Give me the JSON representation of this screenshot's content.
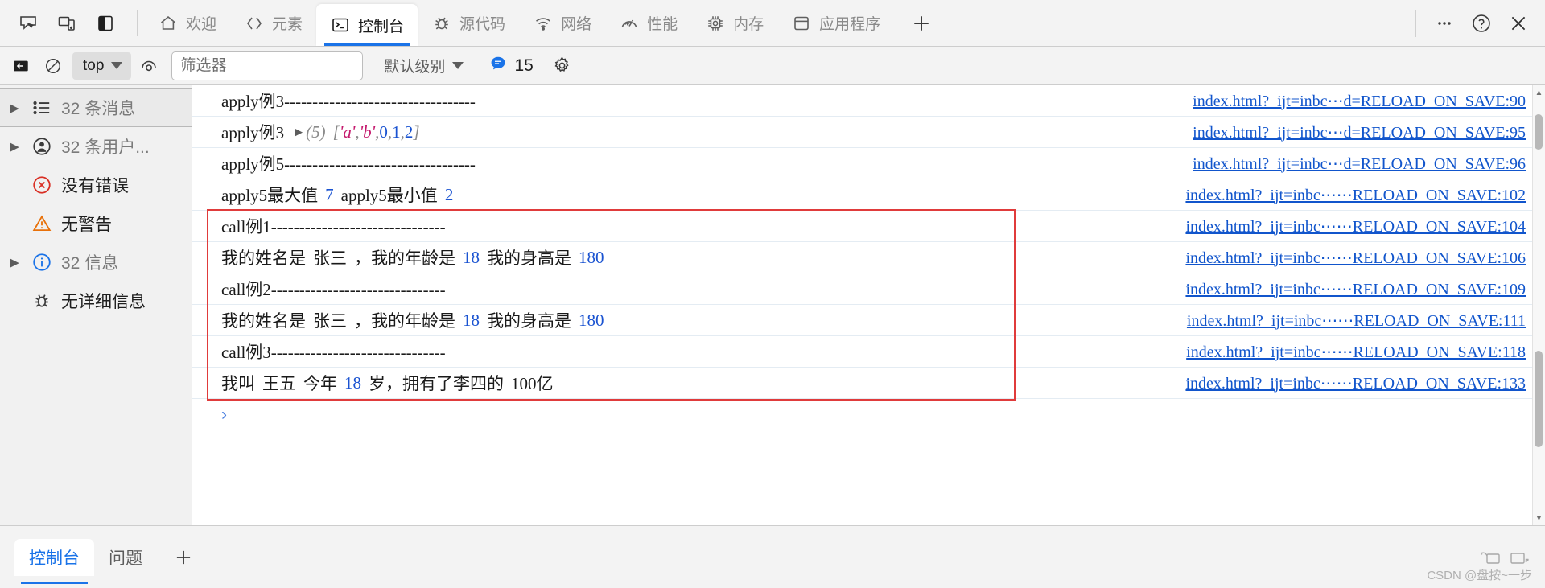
{
  "window": {
    "devtools_icons": [
      "inspect-element-icon",
      "device-toolbar-icon",
      "dock-panel-icon"
    ],
    "more_label": "⋯",
    "help_label": "?",
    "close_label": "✕"
  },
  "tabs": [
    {
      "id": "welcome",
      "label": "欢迎",
      "icon": "home-icon",
      "active": false
    },
    {
      "id": "elements",
      "label": "元素",
      "icon": "code-icon",
      "active": false
    },
    {
      "id": "console",
      "label": "控制台",
      "icon": "console-icon",
      "active": true
    },
    {
      "id": "sources",
      "label": "源代码",
      "icon": "bug-icon",
      "active": false
    },
    {
      "id": "network",
      "label": "网络",
      "icon": "wifi-icon",
      "active": false
    },
    {
      "id": "performance",
      "label": "性能",
      "icon": "gauge-icon",
      "active": false
    },
    {
      "id": "memory",
      "label": "内存",
      "icon": "chip-icon",
      "active": false
    },
    {
      "id": "application",
      "label": "应用程序",
      "icon": "database-icon",
      "active": false
    }
  ],
  "tab_add_label": "+",
  "console_toolbar": {
    "sidebar_toggle_icon": "show-console-sidebar-icon",
    "clear_icon": "clear-console-icon",
    "context": "top",
    "eye_icon": "live-expression-icon",
    "filter_placeholder": "筛选器",
    "filter_value": "",
    "level_label": "默认级别",
    "message_count": "15",
    "message_icon": "speech-bubble-icon",
    "settings_icon": "gear-icon",
    "accent_blue": "#1a73e8"
  },
  "sidebar": {
    "items": [
      {
        "label": "32 条消息",
        "icon": "list-icon",
        "arrow": true,
        "selected": true,
        "tone": "muted"
      },
      {
        "label": "32 条用户...",
        "icon": "user-icon",
        "arrow": true,
        "selected": false,
        "tone": "muted"
      },
      {
        "label": "没有错误",
        "icon": "error-icon",
        "arrow": false,
        "selected": false,
        "tone": "dark"
      },
      {
        "label": "无警告",
        "icon": "warning-icon",
        "arrow": false,
        "selected": false,
        "tone": "dark"
      },
      {
        "label": "32 信息",
        "icon": "info-icon",
        "arrow": true,
        "selected": false,
        "tone": "muted"
      },
      {
        "label": "无详细信息",
        "icon": "verbose-bug-icon",
        "arrow": false,
        "selected": false,
        "tone": "dark"
      }
    ]
  },
  "console_logs": [
    {
      "parts": [
        {
          "t": "text",
          "v": "apply例3----------------------------------"
        }
      ],
      "source": "index.html?_ijt=inbc⋯d=RELOAD_ON_SAVE:90"
    },
    {
      "parts": [
        {
          "t": "text",
          "v": "apply例3"
        },
        {
          "t": "gap"
        },
        {
          "t": "disclose",
          "v": "▶"
        },
        {
          "t": "meta",
          "v": "(5)"
        },
        {
          "t": "gap"
        },
        {
          "t": "meta",
          "v": "["
        },
        {
          "t": "str",
          "v": "'a'"
        },
        {
          "t": "meta",
          "v": ", "
        },
        {
          "t": "str",
          "v": "'b'"
        },
        {
          "t": "meta",
          "v": ", "
        },
        {
          "t": "num",
          "v": "0"
        },
        {
          "t": "meta",
          "v": ", "
        },
        {
          "t": "num",
          "v": "1"
        },
        {
          "t": "meta",
          "v": ", "
        },
        {
          "t": "num",
          "v": "2"
        },
        {
          "t": "meta",
          "v": "]"
        }
      ],
      "source": "index.html?_ijt=inbc⋯d=RELOAD_ON_SAVE:95"
    },
    {
      "parts": [
        {
          "t": "text",
          "v": "apply例5----------------------------------"
        }
      ],
      "source": "index.html?_ijt=inbc⋯d=RELOAD_ON_SAVE:96"
    },
    {
      "parts": [
        {
          "t": "text",
          "v": "apply5最大值"
        },
        {
          "t": "gap"
        },
        {
          "t": "num",
          "v": "7"
        },
        {
          "t": "gap"
        },
        {
          "t": "text",
          "v": "apply5最小值"
        },
        {
          "t": "gap"
        },
        {
          "t": "num",
          "v": "2"
        }
      ],
      "source": "index.html?_ijt=inbc⋯⋯RELOAD_ON_SAVE:102"
    },
    {
      "parts": [
        {
          "t": "text",
          "v": "call例1-------------------------------"
        }
      ],
      "source": "index.html?_ijt=inbc⋯⋯RELOAD_ON_SAVE:104",
      "boxed": true
    },
    {
      "parts": [
        {
          "t": "text",
          "v": "我的姓名是"
        },
        {
          "t": "gap"
        },
        {
          "t": "text",
          "v": "张三"
        },
        {
          "t": "gap"
        },
        {
          "t": "text",
          "v": "，我的年龄是"
        },
        {
          "t": "gap"
        },
        {
          "t": "num",
          "v": "18"
        },
        {
          "t": "gap"
        },
        {
          "t": "text",
          "v": "我的身高是"
        },
        {
          "t": "gap"
        },
        {
          "t": "num",
          "v": "180"
        }
      ],
      "source": "index.html?_ijt=inbc⋯⋯RELOAD_ON_SAVE:106",
      "boxed": true
    },
    {
      "parts": [
        {
          "t": "text",
          "v": "call例2-------------------------------"
        }
      ],
      "source": "index.html?_ijt=inbc⋯⋯RELOAD_ON_SAVE:109",
      "boxed": true
    },
    {
      "parts": [
        {
          "t": "text",
          "v": "我的姓名是"
        },
        {
          "t": "gap"
        },
        {
          "t": "text",
          "v": "张三"
        },
        {
          "t": "gap"
        },
        {
          "t": "text",
          "v": "，我的年龄是"
        },
        {
          "t": "gap"
        },
        {
          "t": "num",
          "v": "18"
        },
        {
          "t": "gap"
        },
        {
          "t": "text",
          "v": "我的身高是"
        },
        {
          "t": "gap"
        },
        {
          "t": "num",
          "v": "180"
        }
      ],
      "source": "index.html?_ijt=inbc⋯⋯RELOAD_ON_SAVE:111",
      "boxed": true
    },
    {
      "parts": [
        {
          "t": "text",
          "v": "call例3-------------------------------"
        }
      ],
      "source": "index.html?_ijt=inbc⋯⋯RELOAD_ON_SAVE:118",
      "boxed": true
    },
    {
      "parts": [
        {
          "t": "text",
          "v": "我叫"
        },
        {
          "t": "gap"
        },
        {
          "t": "text",
          "v": "王五"
        },
        {
          "t": "gap"
        },
        {
          "t": "text",
          "v": "今年"
        },
        {
          "t": "gap"
        },
        {
          "t": "num",
          "v": "18"
        },
        {
          "t": "gap"
        },
        {
          "t": "text",
          "v": "岁，拥有了李四的"
        },
        {
          "t": "gap"
        },
        {
          "t": "text",
          "v": "100亿"
        }
      ],
      "source": "index.html?_ijt=inbc⋯⋯RELOAD_ON_SAVE:133",
      "boxed": true
    }
  ],
  "prompt": {
    "chevron": "›",
    "value": ""
  },
  "highlight_box": {
    "color": "#e03b3b"
  },
  "drawer": {
    "tabs": [
      {
        "label": "控制台",
        "active": true
      },
      {
        "label": "问题",
        "active": false
      }
    ],
    "add_label": "+"
  },
  "watermark": {
    "text": "CSDN @盘按~一步"
  }
}
